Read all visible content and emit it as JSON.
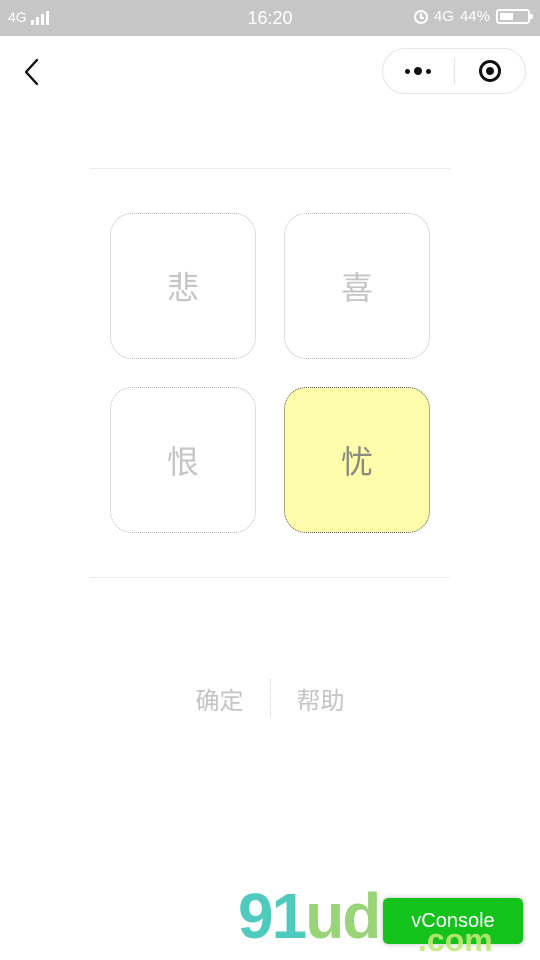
{
  "status_bar": {
    "network_left": "4G",
    "time": "16:20",
    "network_right": "4G",
    "battery": "44%",
    "battery_level": 0.44
  },
  "nav": {
    "back_icon": "chevron-left-icon",
    "more_icon": "more-dots-icon",
    "close_icon": "target-circle-icon"
  },
  "tiles": [
    {
      "label": "悲",
      "selected": false
    },
    {
      "label": "喜",
      "selected": false
    },
    {
      "label": "恨",
      "selected": false
    },
    {
      "label": "忧",
      "selected": true
    }
  ],
  "actions": {
    "confirm": "确定",
    "help": "帮助"
  },
  "overlay": {
    "watermark_prefix": "91",
    "watermark_mid": "ud",
    "watermark_suffix": ".com",
    "vconsole_label": "vConsole"
  },
  "colors": {
    "selected_bg": "#fdfdac",
    "status_bar_bg": "#c6c6c6",
    "vconsole_bg": "#13c21a"
  }
}
